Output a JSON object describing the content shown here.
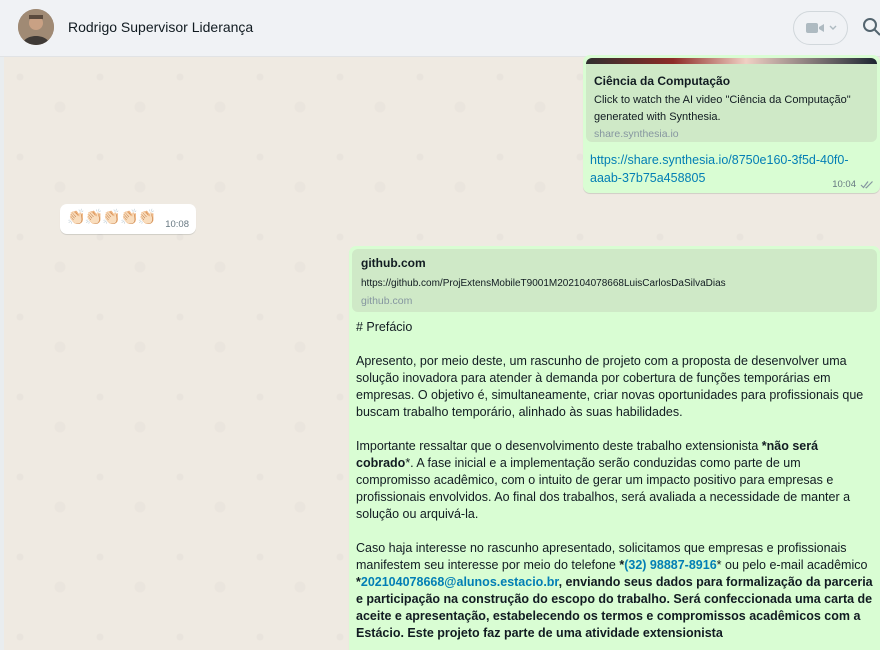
{
  "header": {
    "contact_name": "Rodrigo Supervisor Liderança",
    "video_icon": "video-camera-icon",
    "search_icon": "search-icon"
  },
  "messages": {
    "synthesia": {
      "preview_title": "Ciência da Computação",
      "preview_desc": "Click to watch the AI video \"Ciência da Computação\" generated with Synthesia.",
      "preview_domain": "share.synthesia.io",
      "link_line1": "https://share.synthesia.io/8750e160-3f5d-40f0-",
      "link_line2": "aaab-37b75a458805",
      "time": "10:04"
    },
    "clap": {
      "emoji": "👏🏻👏🏻👏🏻👏🏻👏🏻",
      "time": "10:08"
    },
    "github": {
      "preview_title": "github.com",
      "preview_url": "https://github.com/ProjExtensMobileT9001M202104078668LuisCarlosDaSilvaDias",
      "preview_domain": "github.com",
      "heading": "# Prefácio",
      "para1": "Apresento, por meio deste, um rascunho de projeto com a proposta de desenvolver uma solução inovadora para atender à demanda por cobertura de funções temporárias em empresas. O objetivo é, simultaneamente, criar novas oportunidades para profissionais que buscam trabalho temporário, alinhado às suas habilidades.",
      "para2_start": "Importante ressaltar que o desenvolvimento deste trabalho extensionista ",
      "para2_bold": "*não será cobrado",
      "para2_end": "*. A fase inicial e a implementação serão conduzidas como parte de um compromisso acadêmico, com o intuito de gerar um impacto positivo para empresas e profissionais envolvidos. Ao final dos trabalhos, será avaliada a necessidade de manter a solução ou arquivá-la.",
      "para3_start": "Caso haja interesse no rascunho apresentado, solicitamos que empresas e profissionais manifestem seu interesse por meio do telefone ",
      "para3_phone_star": "*",
      "para3_phone": "(32) 98887-8916",
      "para3_mid": "* ou pelo e-mail acadêmico ",
      "para3_email_star": "*",
      "para3_email": "202104078668@alunos.estacio.br",
      "para3_bold": ", enviando seus dados para formalização da parceria e participação na construção do escopo do trabalho. Será confeccionada uma carta de aceite e apresentação, estabelecendo os termos e compromissos acadêmicos com a Estácio. Este projeto faz parte de uma atividade extensionista"
    }
  },
  "colors": {
    "outgoing_bubble": "#d9fdd3",
    "incoming_bubble": "#ffffff",
    "link": "#027eb5",
    "chat_bg": "#efeae2"
  }
}
